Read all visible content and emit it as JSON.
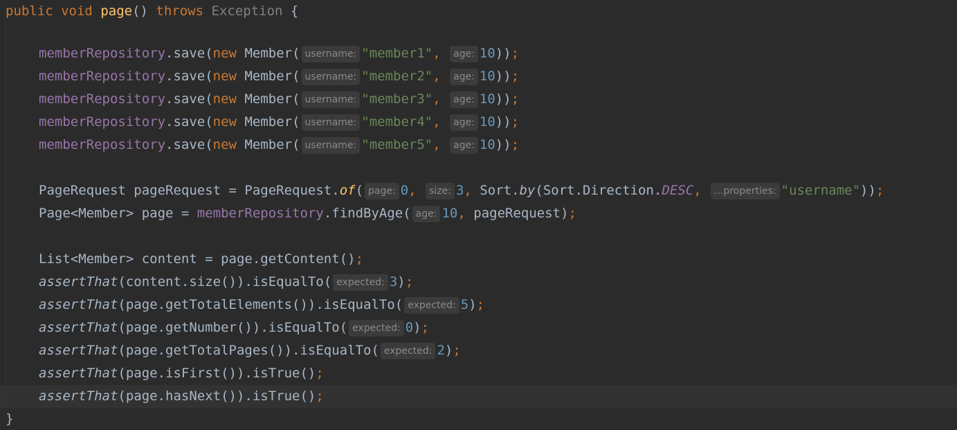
{
  "code": {
    "line0": {
      "kw_public": "public",
      "kw_void": "void",
      "method": "page",
      "parens": "()",
      "kw_throws": "throws",
      "exception": "Exception",
      "brace_open": "{"
    },
    "save_lines": [
      {
        "repo": "memberRepository",
        "call": ".save(",
        "kw_new": "new",
        "ctor": "Member(",
        "hint_username": "username:",
        "username": "\"member1\"",
        "comma": ",",
        "hint_age": "age:",
        "age": "10",
        "close": "))",
        "semi": ";"
      },
      {
        "repo": "memberRepository",
        "call": ".save(",
        "kw_new": "new",
        "ctor": "Member(",
        "hint_username": "username:",
        "username": "\"member2\"",
        "comma": ",",
        "hint_age": "age:",
        "age": "10",
        "close": "))",
        "semi": ";"
      },
      {
        "repo": "memberRepository",
        "call": ".save(",
        "kw_new": "new",
        "ctor": "Member(",
        "hint_username": "username:",
        "username": "\"member3\"",
        "comma": ",",
        "hint_age": "age:",
        "age": "10",
        "close": "))",
        "semi": ";"
      },
      {
        "repo": "memberRepository",
        "call": ".save(",
        "kw_new": "new",
        "ctor": "Member(",
        "hint_username": "username:",
        "username": "\"member4\"",
        "comma": ",",
        "hint_age": "age:",
        "age": "10",
        "close": "))",
        "semi": ";"
      },
      {
        "repo": "memberRepository",
        "call": ".save(",
        "kw_new": "new",
        "ctor": "Member(",
        "hint_username": "username:",
        "username": "\"member5\"",
        "comma": ",",
        "hint_age": "age:",
        "age": "10",
        "close": "))",
        "semi": ";"
      }
    ],
    "line8": {
      "pre": "PageRequest pageRequest = PageRequest.",
      "of": "of",
      "paren": "(",
      "hint_page": "page:",
      "page_val": "0",
      "comma1": ",",
      "hint_size": "size:",
      "size_val": "3",
      "comma2": ",",
      "sort_pre": "Sort.",
      "by": "by",
      "sort_mid": "(Sort.Direction.",
      "desc": "DESC",
      "comma3": ",",
      "hint_props": "...properties:",
      "prop_val": "\"username\"",
      "close": "))",
      "semi": ";"
    },
    "line9": {
      "pre": "Page<Member> page = ",
      "repo": "memberRepository",
      "call": ".findByAge(",
      "hint_age": "age:",
      "age_val": "10",
      "comma": ",",
      "rest": "pageRequest)",
      "semi": ";"
    },
    "line11": {
      "text": "List<Member> content = page.getContent()",
      "semi": ";"
    },
    "asserts": [
      {
        "fn": "assertThat",
        "arg": "(content.size()).isEqualTo(",
        "hint": "expected:",
        "val": "3",
        "close": ")",
        "semi": ";"
      },
      {
        "fn": "assertThat",
        "arg": "(page.getTotalElements()).isEqualTo(",
        "hint": "expected:",
        "val": "5",
        "close": ")",
        "semi": ";"
      },
      {
        "fn": "assertThat",
        "arg": "(page.getNumber()).isEqualTo(",
        "hint": "expected:",
        "val": "0",
        "close": ")",
        "semi": ";"
      },
      {
        "fn": "assertThat",
        "arg": "(page.getTotalPages()).isEqualTo(",
        "hint": "expected:",
        "val": "2",
        "close": ")",
        "semi": ";"
      }
    ],
    "bool_asserts": [
      {
        "fn": "assertThat",
        "arg": "(page.isFirst()).isTrue()",
        "semi": ";"
      },
      {
        "fn": "assertThat",
        "arg": "(page.hasNext()).isTrue()",
        "semi": ";"
      }
    ],
    "closing_brace": "}"
  },
  "colors": {
    "background": "#2b2b2b",
    "keyword": "#cc7832",
    "method": "#ffc66d",
    "field": "#9876aa",
    "string": "#6a8759",
    "number": "#6897bb",
    "text": "#a9b7c6",
    "hint_bg": "#3b3b3b"
  }
}
